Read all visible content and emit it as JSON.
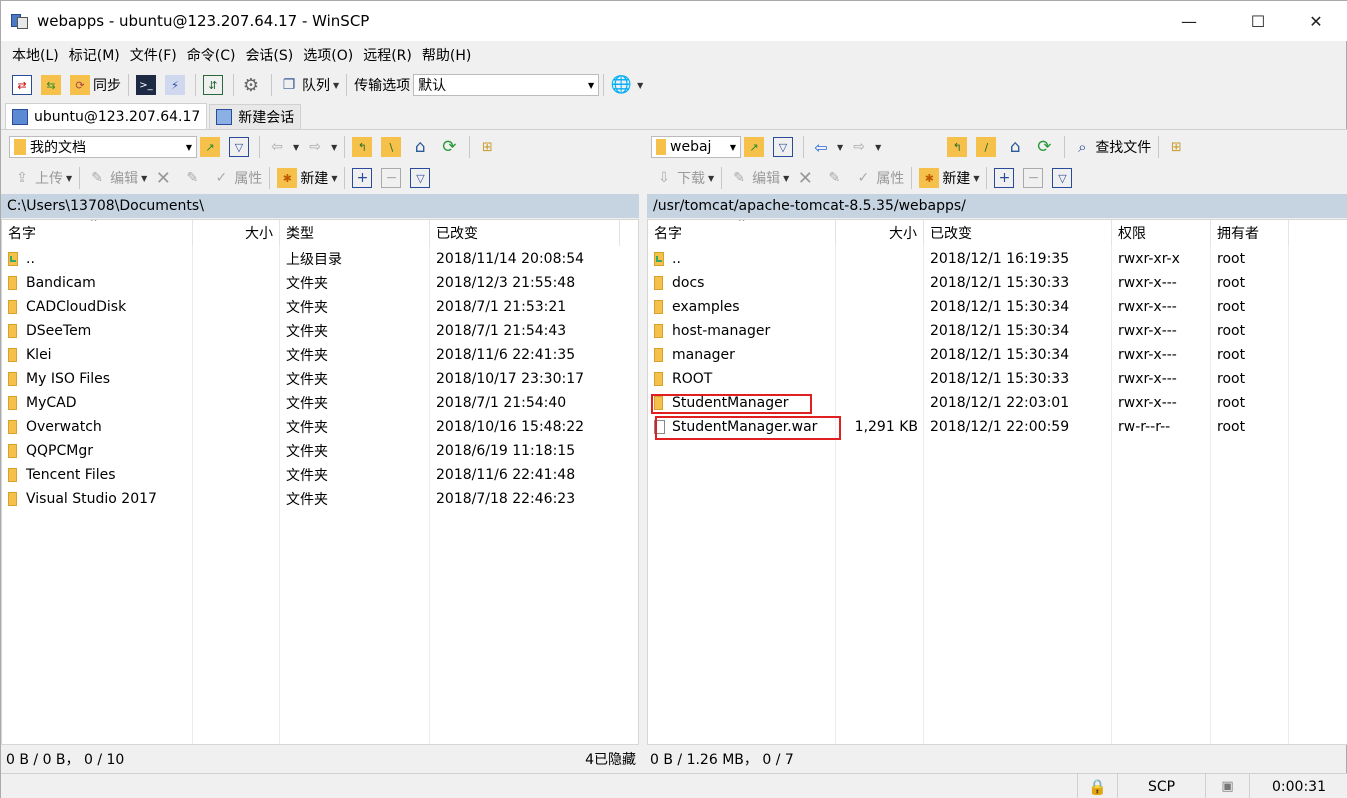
{
  "window": {
    "title": "webapps - ubuntu@123.207.64.17 - WinSCP",
    "minimize_glyph": "—",
    "maximize_glyph": "☐",
    "close_glyph": "✕"
  },
  "menu": [
    "本地(L)",
    "标记(M)",
    "文件(F)",
    "命令(C)",
    "会话(S)",
    "选项(O)",
    "远程(R)",
    "帮助(H)"
  ],
  "main_toolbar": {
    "sync_label": "同步",
    "queue_label": "队列",
    "transfer_options_label": "传输选项",
    "transfer_preset": "默认"
  },
  "tabs": [
    {
      "label": "ubuntu@123.207.64.17",
      "active": true
    },
    {
      "label": "新建会话",
      "active": false
    }
  ],
  "local": {
    "location": "我的文档",
    "upload_label": "上传",
    "edit_label": "编辑",
    "properties_label": "属性",
    "new_label": "新建",
    "path": "C:\\Users\\13708\\Documents\\",
    "columns": [
      "名字",
      "大小",
      "类型",
      "已改变"
    ],
    "rows": [
      {
        "name": "..",
        "size": "",
        "type": "上级目录",
        "changed": "2018/11/14  20:08:54",
        "kind": "parent"
      },
      {
        "name": "Bandicam",
        "size": "",
        "type": "文件夹",
        "changed": "2018/12/3  21:55:48",
        "kind": "folder"
      },
      {
        "name": "CADCloudDisk",
        "size": "",
        "type": "文件夹",
        "changed": "2018/7/1  21:53:21",
        "kind": "folder"
      },
      {
        "name": "DSeeTem",
        "size": "",
        "type": "文件夹",
        "changed": "2018/7/1  21:54:43",
        "kind": "folder"
      },
      {
        "name": "Klei",
        "size": "",
        "type": "文件夹",
        "changed": "2018/11/6  22:41:35",
        "kind": "folder"
      },
      {
        "name": "My ISO Files",
        "size": "",
        "type": "文件夹",
        "changed": "2018/10/17  23:30:17",
        "kind": "folder"
      },
      {
        "name": "MyCAD",
        "size": "",
        "type": "文件夹",
        "changed": "2018/7/1  21:54:40",
        "kind": "folder"
      },
      {
        "name": "Overwatch",
        "size": "",
        "type": "文件夹",
        "changed": "2018/10/16  15:48:22",
        "kind": "folder"
      },
      {
        "name": "QQPCMgr",
        "size": "",
        "type": "文件夹",
        "changed": "2018/6/19  11:18:15",
        "kind": "folder"
      },
      {
        "name": "Tencent Files",
        "size": "",
        "type": "文件夹",
        "changed": "2018/11/6  22:41:48",
        "kind": "folder"
      },
      {
        "name": "Visual Studio 2017",
        "size": "",
        "type": "文件夹",
        "changed": "2018/7/18  22:46:23",
        "kind": "folder"
      }
    ],
    "status": "0 B / 0 B， 0 / 10",
    "hidden": "4已隐藏"
  },
  "remote": {
    "location": "webaj",
    "find_files_label": "查找文件",
    "download_label": "下载",
    "edit_label": "编辑",
    "properties_label": "属性",
    "new_label": "新建",
    "path": "/usr/tomcat/apache-tomcat-8.5.35/webapps/",
    "columns": [
      "名字",
      "大小",
      "已改变",
      "权限",
      "拥有者"
    ],
    "rows": [
      {
        "name": "..",
        "size": "",
        "changed": "2018/12/1 16:19:35",
        "rights": "rwxr-xr-x",
        "owner": "root",
        "kind": "parent"
      },
      {
        "name": "docs",
        "size": "",
        "changed": "2018/12/1 15:30:33",
        "rights": "rwxr-x---",
        "owner": "root",
        "kind": "folder"
      },
      {
        "name": "examples",
        "size": "",
        "changed": "2018/12/1 15:30:34",
        "rights": "rwxr-x---",
        "owner": "root",
        "kind": "folder"
      },
      {
        "name": "host-manager",
        "size": "",
        "changed": "2018/12/1 15:30:34",
        "rights": "rwxr-x---",
        "owner": "root",
        "kind": "folder"
      },
      {
        "name": "manager",
        "size": "",
        "changed": "2018/12/1 15:30:34",
        "rights": "rwxr-x---",
        "owner": "root",
        "kind": "folder"
      },
      {
        "name": "ROOT",
        "size": "",
        "changed": "2018/12/1 15:30:33",
        "rights": "rwxr-x---",
        "owner": "root",
        "kind": "folder"
      },
      {
        "name": "StudentManager",
        "size": "",
        "changed": "2018/12/1 22:03:01",
        "rights": "rwxr-x---",
        "owner": "root",
        "kind": "folder"
      },
      {
        "name": "StudentManager.war",
        "size": "1,291 KB",
        "changed": "2018/12/1 22:00:59",
        "rights": "rw-r--r--",
        "owner": "root",
        "kind": "file"
      }
    ],
    "status": "0 B / 1.26 MB， 0 / 7"
  },
  "bottom": {
    "protocol": "SCP",
    "elapsed": "0:00:31"
  }
}
